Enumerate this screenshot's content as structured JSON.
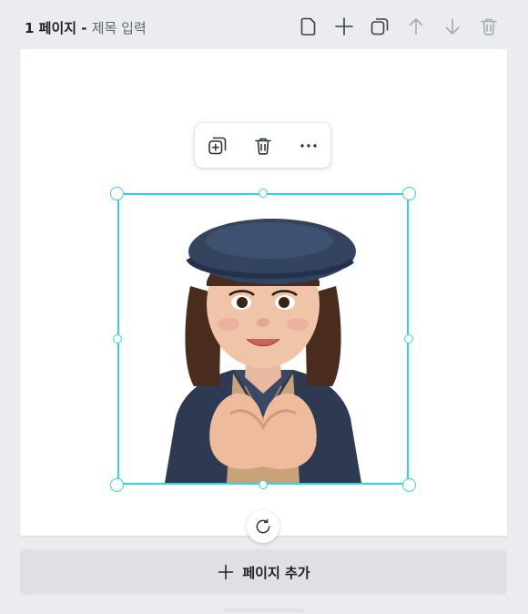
{
  "header": {
    "page_number": "1 페이지",
    "separator": " - ",
    "title_placeholder": "제목 입력",
    "actions": [
      {
        "name": "new-page-icon"
      },
      {
        "name": "plus-icon"
      },
      {
        "name": "duplicate-icon"
      },
      {
        "name": "arrow-up-icon"
      },
      {
        "name": "arrow-down-icon"
      },
      {
        "name": "trash-icon"
      }
    ]
  },
  "element_toolbar": {
    "actions": [
      {
        "name": "duplicate-element-icon"
      },
      {
        "name": "delete-element-icon"
      },
      {
        "name": "more-options-icon"
      }
    ]
  },
  "selection": {
    "color": "#35d2e6",
    "content": "memoji-avatar-image"
  },
  "footer": {
    "add_page_label": "페이지 추가"
  },
  "colors": {
    "background": "#ebecef",
    "canvas": "#ffffff",
    "accent": "#35d2e6",
    "icon": "#4a4f5a"
  }
}
